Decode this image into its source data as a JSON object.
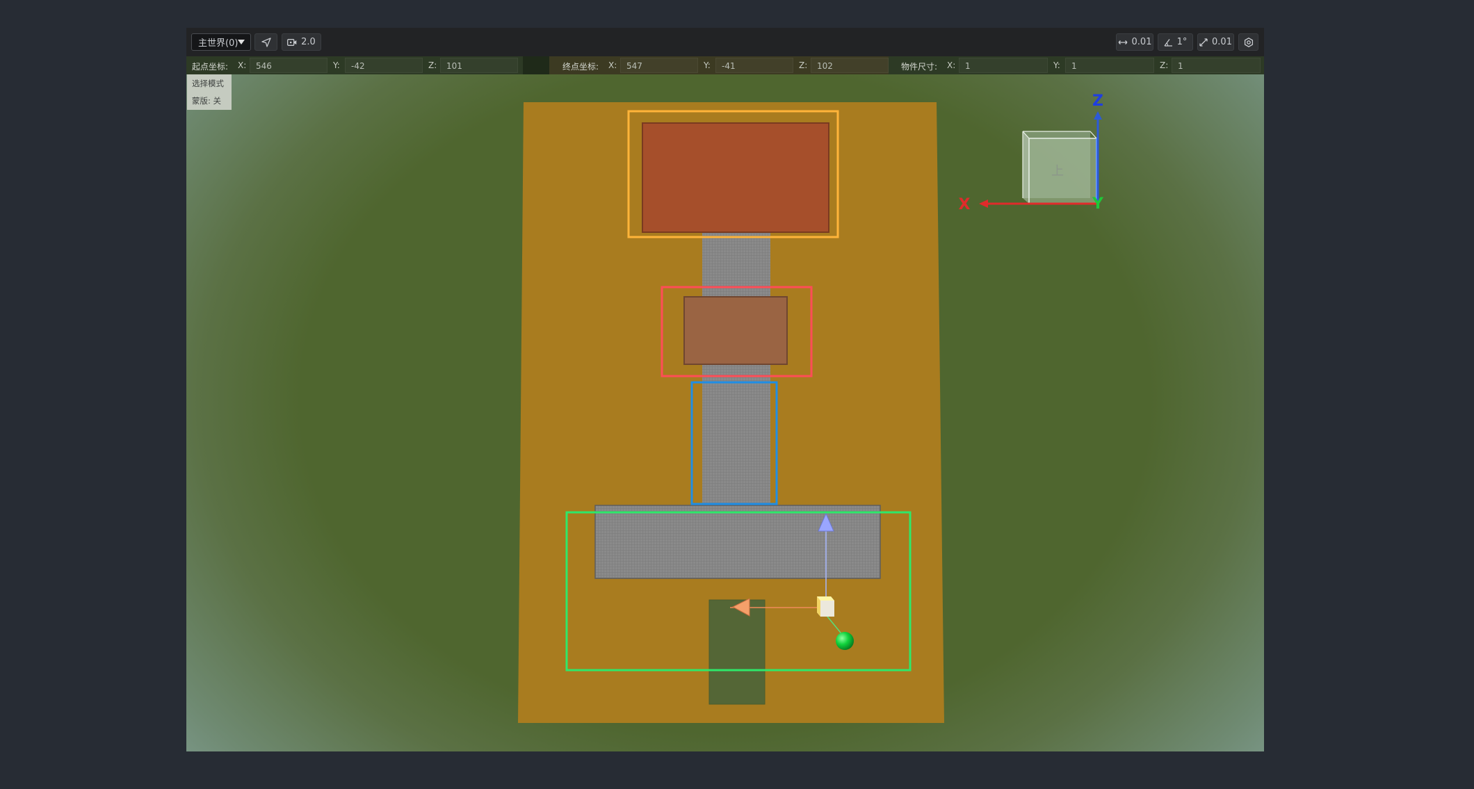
{
  "toolbar": {
    "world_select": "主世界(0)",
    "camera_speed": "2.0",
    "move_snap": "0.01",
    "rotate_snap": "1°",
    "scale_snap": "0.01"
  },
  "coords": {
    "start": {
      "label": "起点坐标:",
      "x_label": "X:",
      "x": "546",
      "y_label": "Y:",
      "y": "-42",
      "z_label": "Z:",
      "z": "101"
    },
    "end": {
      "label": "终点坐标:",
      "x_label": "X:",
      "x": "547",
      "y_label": "Y:",
      "y": "-41",
      "z_label": "Z:",
      "z": "102"
    },
    "size": {
      "label": "物件尺寸:",
      "x_label": "X:",
      "x": "1",
      "y_label": "Y:",
      "y": "1",
      "z_label": "Z:",
      "z": "1"
    }
  },
  "mode_panel": {
    "select_mode": "选择模式",
    "mask": "蒙版: 关"
  },
  "orientation_cube": {
    "face_label": "上",
    "z_axis": "Z",
    "x_axis": "X",
    "y_axis": "Y"
  },
  "colors": {
    "ground": "#4f662f",
    "platform": "#a97c1f",
    "roof_top": "#a64f2b",
    "roof_mid": "#9a6443",
    "path": "#868686",
    "box_orange": "#ffb43a",
    "box_red": "#ff4d57",
    "box_blue": "#1f8ee5",
    "box_green": "#2ee86a"
  }
}
